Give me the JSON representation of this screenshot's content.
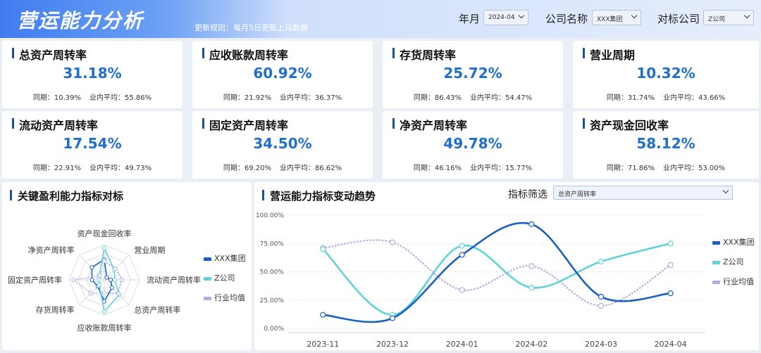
{
  "header": {
    "title": "营运能力分析",
    "update_rule": "更新规则：每月5日更新上月数据",
    "filters": {
      "month_label": "年月",
      "month_value": "2024-04",
      "company_label": "公司名称",
      "company_value": "XXX集团",
      "benchmark_label": "对标公司",
      "benchmark_value": "Z公司"
    }
  },
  "cards": [
    {
      "title": "总资产周转率",
      "value": "31.18%",
      "yoy": "同期：10.39%",
      "avg": "业内平均：55.86%"
    },
    {
      "title": "应收账款周转率",
      "value": "60.92%",
      "yoy": "同期：21.92%",
      "avg": "业内平均：36.37%"
    },
    {
      "title": "存货周转率",
      "value": "25.72%",
      "yoy": "同期：86.43%",
      "avg": "业内平均：54.47%"
    },
    {
      "title": "营业周期",
      "value": "10.32%",
      "yoy": "同期：31.74%",
      "avg": "业内平均：43.66%"
    },
    {
      "title": "流动资产周转率",
      "value": "17.54%",
      "yoy": "同期：22.91%",
      "avg": "业内平均：49.73%"
    },
    {
      "title": "固定资产周转率",
      "value": "34.50%",
      "yoy": "同期：69.20%",
      "avg": "业内平均：86.62%"
    },
    {
      "title": "净资产周转率",
      "value": "49.78%",
      "yoy": "同期：46.16%",
      "avg": "业内平均：15.77%"
    },
    {
      "title": "资产现金回收率",
      "value": "58.12%",
      "yoy": "同期：71.86%",
      "avg": "业内平均：53.00%"
    }
  ],
  "radar_panel": {
    "title": "关键盈利能力指标对标"
  },
  "trend_panel": {
    "title": "营运能力指标变动趋势",
    "filter_label": "指标筛选",
    "filter_value": "总资产周转率"
  },
  "colors": {
    "series1": "#1a5fc4",
    "series2": "#5fd3d8",
    "series3": "#b9a9e8",
    "accent": "#1f6fd1"
  },
  "chart_data": [
    {
      "type": "radar",
      "axes": [
        "资产现金回收率",
        "营业周期",
        "流动资产周转率",
        "总资产周转率",
        "应收账款周转率",
        "存货周转率",
        "固定资产周转率",
        "净资产周转率"
      ],
      "rmax": 100,
      "series": [
        {
          "name": "XXX集团",
          "values": [
            58,
            10,
            18,
            31,
            61,
            26,
            35,
            50
          ]
        },
        {
          "name": "Z公司",
          "values": [
            90,
            40,
            30,
            60,
            90,
            20,
            15,
            20
          ]
        },
        {
          "name": "行业均值",
          "values": [
            53,
            44,
            50,
            56,
            36,
            54,
            87,
            16
          ]
        }
      ],
      "legend_position": "right"
    },
    {
      "type": "line",
      "categories": [
        "2023-11",
        "2023-12",
        "2024-01",
        "2024-02",
        "2024-03",
        "2024-04"
      ],
      "ylim": [
        0,
        100
      ],
      "yticks": [
        "0.00%",
        "25.00%",
        "50.00%",
        "75.00%",
        "100.00%"
      ],
      "series": [
        {
          "name": "XXX集团",
          "values": [
            12,
            9,
            65,
            92,
            28,
            31
          ],
          "style": "solid"
        },
        {
          "name": "Z公司",
          "values": [
            70,
            12,
            73,
            36,
            59,
            75
          ],
          "style": "solid"
        },
        {
          "name": "行业均值",
          "values": [
            71,
            76,
            34,
            55,
            20,
            56
          ],
          "style": "dotted"
        }
      ],
      "legend_position": "right"
    }
  ]
}
